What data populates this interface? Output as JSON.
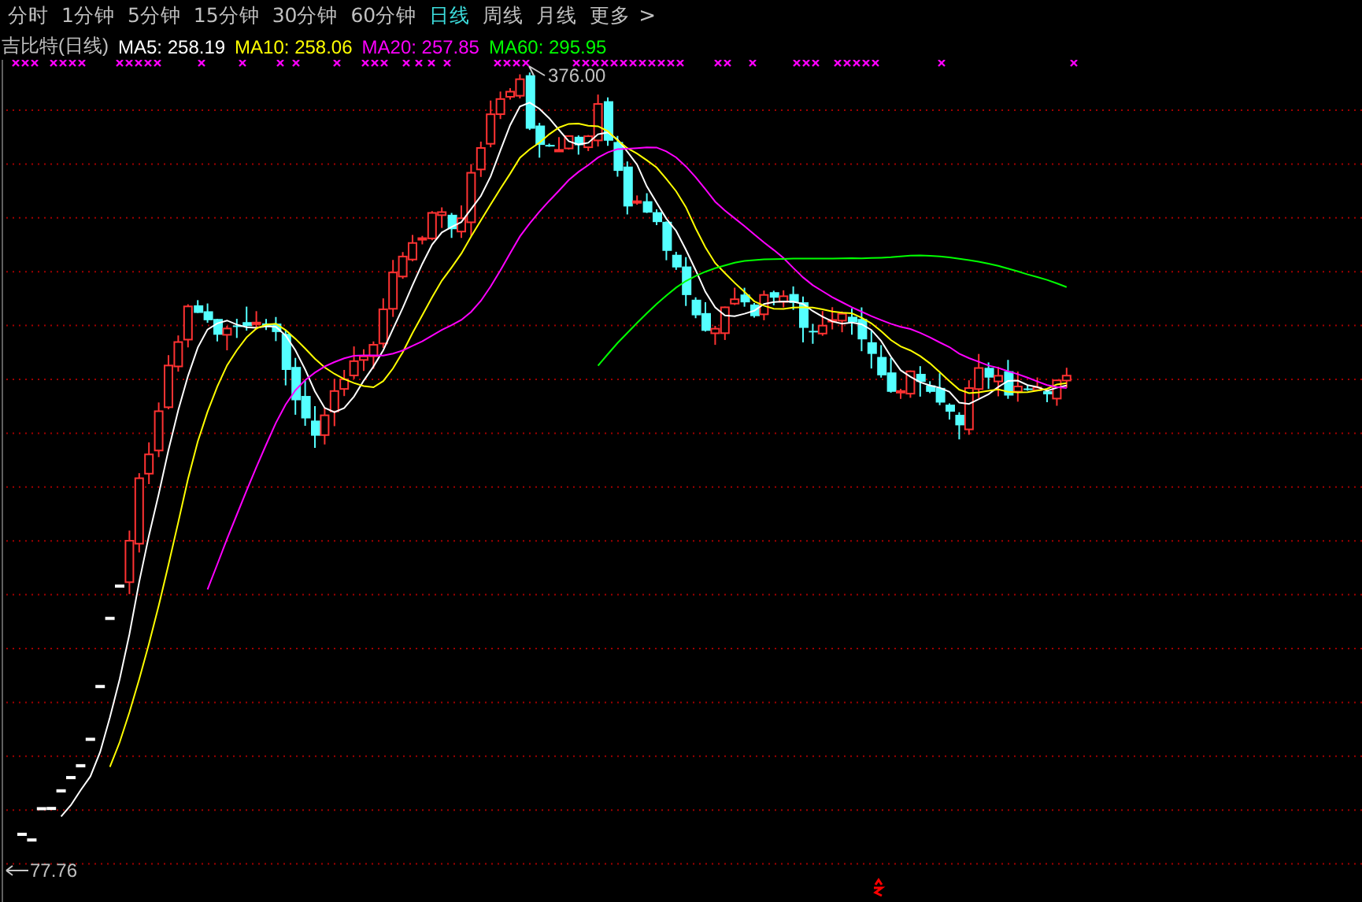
{
  "period_tabs": [
    {
      "label": "分时",
      "selected": false
    },
    {
      "label": "1分钟",
      "selected": false
    },
    {
      "label": "5分钟",
      "selected": false
    },
    {
      "label": "15分钟",
      "selected": false
    },
    {
      "label": "30分钟",
      "selected": false
    },
    {
      "label": "60分钟",
      "selected": false
    },
    {
      "label": "日线",
      "selected": true
    },
    {
      "label": "周线",
      "selected": false
    },
    {
      "label": "月线",
      "selected": false
    },
    {
      "label": "更多",
      "selected": false
    }
  ],
  "more_chevron": ">",
  "legend": {
    "title": "吉比特(日线)",
    "averages": [
      {
        "text": "MA5: 258.19",
        "color": "#ffffff"
      },
      {
        "text": "MA10: 258.06",
        "color": "#ffff00"
      },
      {
        "text": "MA20: 257.85",
        "color": "#ff00ff"
      },
      {
        "text": "MA60: 295.95",
        "color": "#00ff00"
      }
    ]
  },
  "chart": {
    "high_label": "376.00",
    "low_label": "77.76"
  }
}
